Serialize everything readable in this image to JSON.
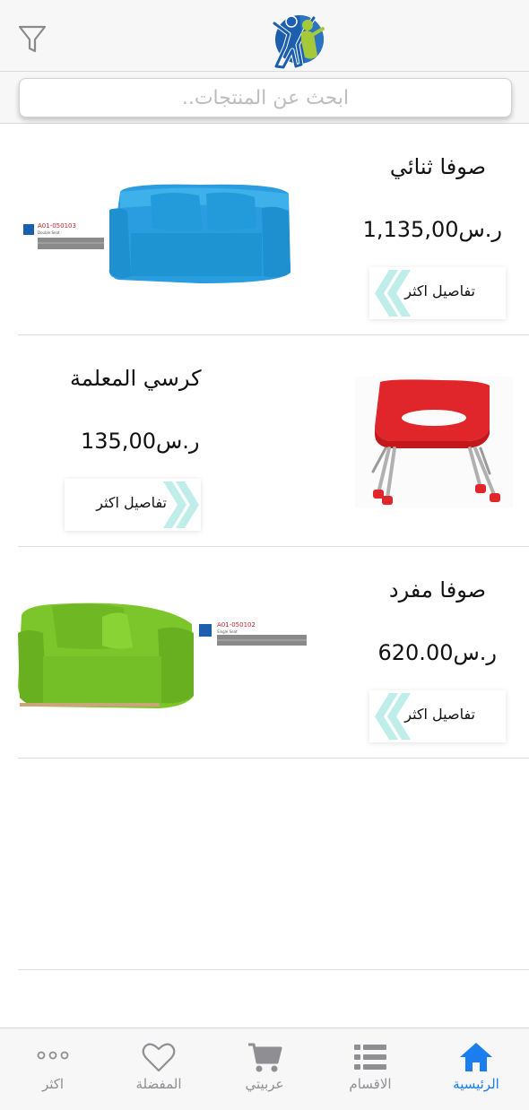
{
  "header": {
    "filter_icon": "filter-icon",
    "logo": "brand-logo"
  },
  "search": {
    "placeholder": "ابحث عن المنتجات.."
  },
  "products": [
    {
      "title": "صوفا ثنائي",
      "price": "1,135,00",
      "currency": "ر.س",
      "details_label": "تفاصيل اكثر",
      "image": "blue-double-sofa",
      "color": "#2a9de0",
      "image_code": "A01-050103",
      "image_caption": "Double Seat"
    },
    {
      "title": "كرسي المعلمة",
      "price": "135,00",
      "currency": "ر.س",
      "details_label": "تفاصيل اكثر",
      "image": "red-chair",
      "color": "#e0262a"
    },
    {
      "title": "صوفا مفرد",
      "price": "620.00",
      "currency": "ر.س",
      "details_label": "تفاصيل اكثر",
      "image": "green-single-sofa",
      "color": "#7cc62c",
      "image_code": "A01-050102",
      "image_caption": "Single Seat"
    }
  ],
  "tabs": [
    {
      "label": "الرئيسية",
      "icon": "home-icon",
      "active": true
    },
    {
      "label": "الاقسام",
      "icon": "list-icon",
      "active": false
    },
    {
      "label": "عربيتي",
      "icon": "cart-icon",
      "active": false
    },
    {
      "label": "المفضلة",
      "icon": "heart-icon",
      "active": false
    },
    {
      "label": "اكثر",
      "icon": "more-icon",
      "active": false
    }
  ],
  "colors": {
    "accent": "#1a7df0",
    "chevron": "#bfeeea",
    "tab_inactive": "#8e8e93"
  }
}
